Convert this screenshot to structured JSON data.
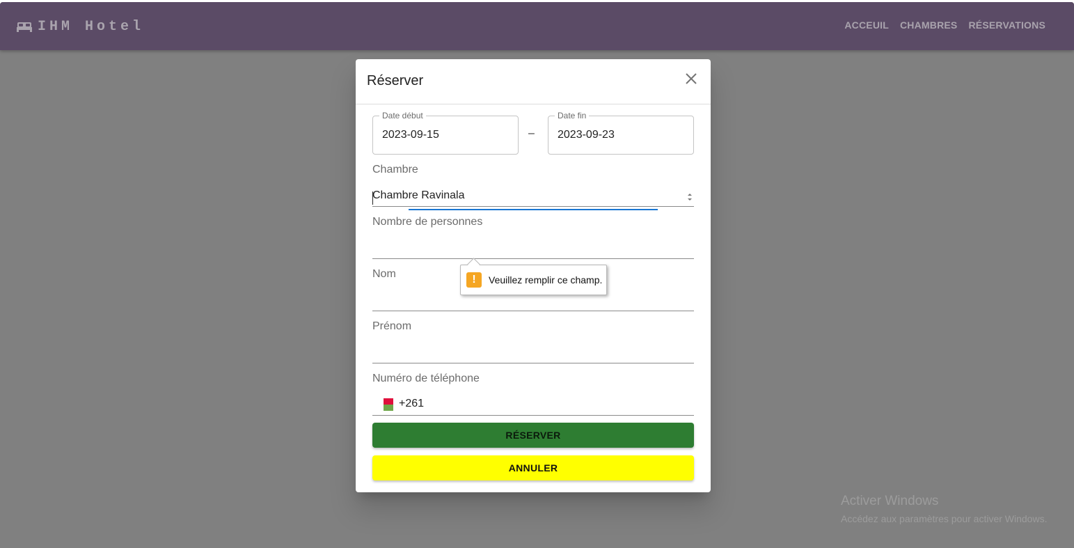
{
  "header": {
    "brand": "IHM Hotel",
    "nav": [
      "ACCEUIL",
      "CHAMBRES",
      "RÉSERVATIONS"
    ]
  },
  "dialog": {
    "title": "Réserver",
    "date_start": {
      "label": "Date début",
      "value": "2023-09-15"
    },
    "date_separator": "–",
    "date_end": {
      "label": "Date fin",
      "value": "2023-09-23"
    },
    "chambre": {
      "label": "Chambre",
      "value": "Chambre Ravinala"
    },
    "personnes": {
      "label": "Nombre de personnes",
      "value": ""
    },
    "nom": {
      "label": "Nom",
      "value": ""
    },
    "prenom": {
      "label": "Prénom",
      "value": ""
    },
    "telephone": {
      "label": "Numéro de téléphone",
      "value": "+261"
    },
    "reserve_button": "RÉSERVER",
    "cancel_button": "ANNULER"
  },
  "validation_tooltip": {
    "icon": "warning-icon",
    "text": "Veuillez remplir ce champ."
  },
  "watermark": {
    "title": "Activer Windows",
    "subtitle": "Accédez aux paramètres pour activer Windows."
  },
  "colors": {
    "appbar": "#5b4b66",
    "reserve_button": "#2e7d32",
    "cancel_button": "#ffff00",
    "focus": "#1976d2",
    "warning": "#f5a623"
  }
}
